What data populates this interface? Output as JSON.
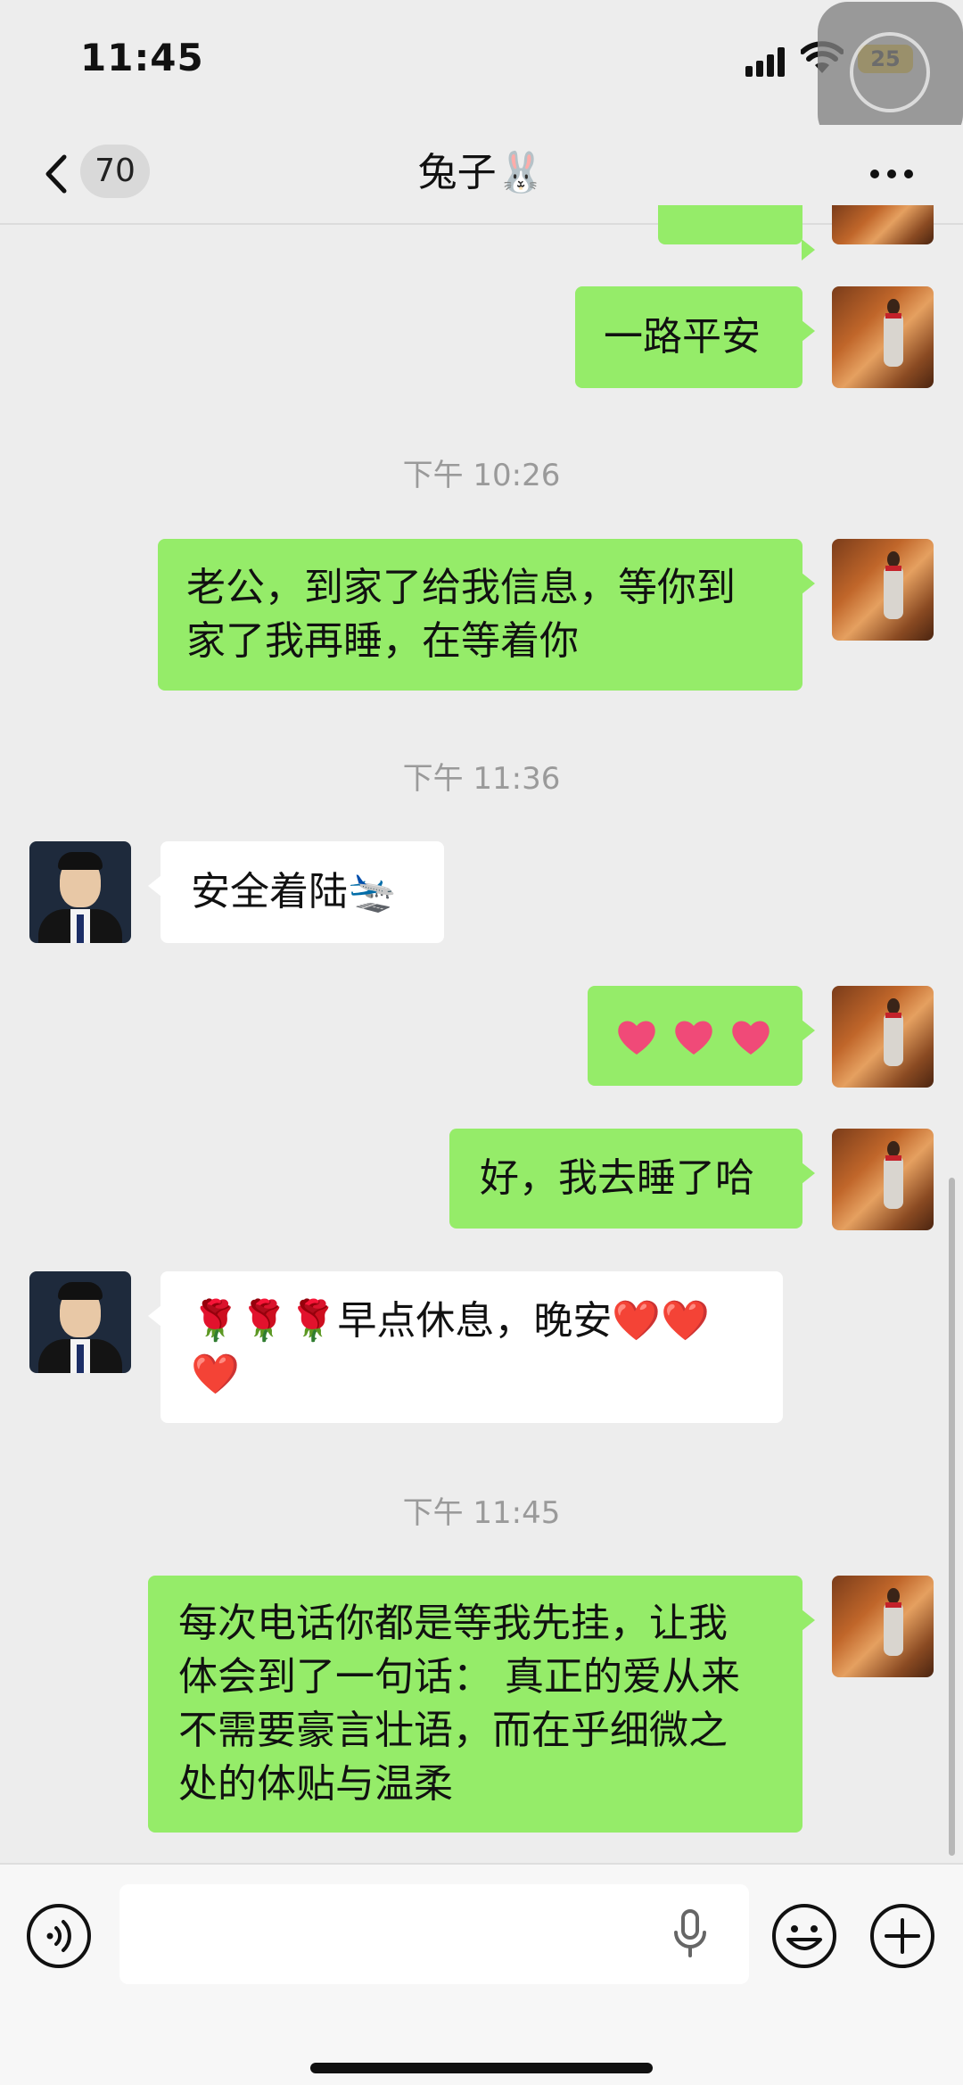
{
  "status_bar": {
    "time": "11:45",
    "battery": "25",
    "icons": [
      "signal-icon",
      "wifi-icon",
      "battery-icon"
    ]
  },
  "nav": {
    "back_icon": "chevron-left-icon",
    "unread_count": "70",
    "title": "兔子🐰",
    "more_icon": "more-dots-icon"
  },
  "messages": [
    {
      "type": "text",
      "sender": "me",
      "text": "一路平安"
    },
    {
      "type": "time",
      "text": "下午 10:26"
    },
    {
      "type": "text",
      "sender": "me",
      "lines": [
        "老公，到家了给我信息，等你到",
        "家了我再睡，在等着你"
      ]
    },
    {
      "type": "time",
      "text": "下午 11:36"
    },
    {
      "type": "text",
      "sender": "other",
      "text": "安全着陆🛬"
    },
    {
      "type": "emoji",
      "sender": "me",
      "emoji": [
        "pink-heart-icon",
        "pink-heart-icon",
        "pink-heart-icon"
      ]
    },
    {
      "type": "text",
      "sender": "me",
      "text": "好，我去睡了哈"
    },
    {
      "type": "text",
      "sender": "other",
      "lines": [
        "🌹🌹🌹早点休息，晚安❤️❤️",
        "❤️"
      ]
    },
    {
      "type": "time",
      "text": "下午 11:45"
    },
    {
      "type": "text",
      "sender": "me",
      "lines": [
        "每次电话你都是等我先挂，让我",
        "体会到了一句话： 真正的爱从来",
        "不需要豪言壮语，而在乎细微之",
        "处的体贴与温柔"
      ]
    }
  ],
  "input_bar": {
    "voice_icon": "voice-mode-icon",
    "placeholder": "",
    "mic_icon": "microphone-icon",
    "emoji_icon": "emoji-icon",
    "plus_icon": "plus-icon"
  },
  "colors": {
    "my_bubble": "#95ec69",
    "their_bubble": "#ffffff",
    "background": "#ededed",
    "battery": "#f2c41f"
  }
}
